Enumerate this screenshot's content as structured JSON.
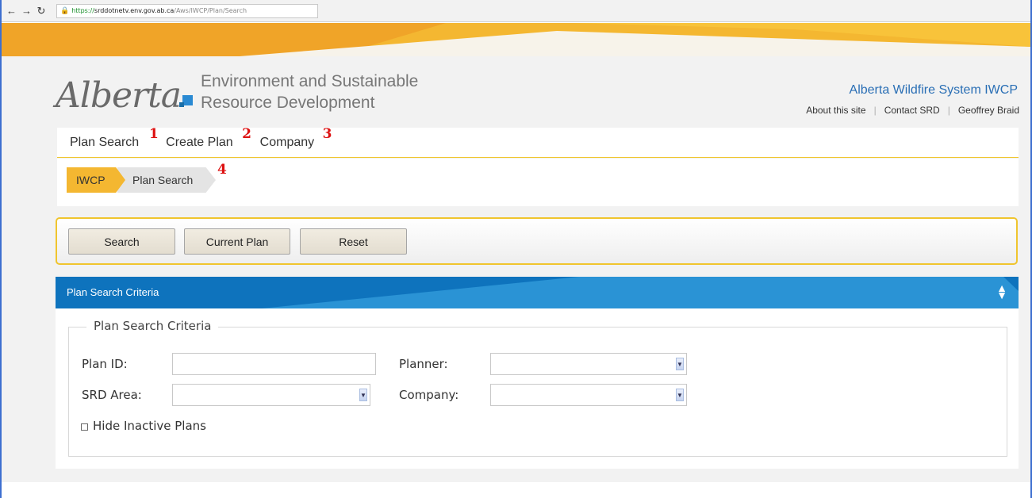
{
  "browser": {
    "back_icon": "back-arrow-icon",
    "forward_icon": "forward-arrow-icon",
    "reload_icon": "reload-icon",
    "url_scheme": "https://",
    "url_host": "srddotnetv.env.gov.ab.ca",
    "url_path": "/Aws/IWCP/Plan/Search"
  },
  "header": {
    "logo_script": "Alberta",
    "logo_line1": "Environment and Sustainable",
    "logo_line2": "Resource Development",
    "system_title": "Alberta Wildfire System IWCP",
    "links": [
      "About this site",
      "Contact SRD",
      "Geoffrey Braid"
    ],
    "separator": "|"
  },
  "nav": {
    "items": [
      {
        "label": "Plan Search",
        "marker": "1"
      },
      {
        "label": "Create Plan",
        "marker": "2"
      },
      {
        "label": "Company",
        "marker": "3"
      }
    ]
  },
  "breadcrumb": {
    "items": [
      "IWCP",
      "Plan Search"
    ],
    "marker": "4"
  },
  "actions": {
    "search": "Search",
    "current_plan": "Current Plan",
    "reset": "Reset"
  },
  "panel": {
    "title": "Plan Search Criteria",
    "toggle_icon": "sort-toggle-icon",
    "fieldset_legend": "Plan Search Criteria",
    "plan_id_label": "Plan ID:",
    "plan_id_value": "",
    "planner_label": "Planner:",
    "planner_value": "",
    "srd_area_label": "SRD Area:",
    "srd_area_value": "",
    "company_label": "Company:",
    "company_value": "",
    "hide_inactive_label": "Hide Inactive Plans",
    "hide_inactive_checked": false
  },
  "colors": {
    "gold": "#f4b731",
    "panel_blue": "#2a93d5",
    "panel_blue_dark": "#0e73bd",
    "title_blue": "#2a6fb5",
    "marker_red": "#dd1111"
  }
}
